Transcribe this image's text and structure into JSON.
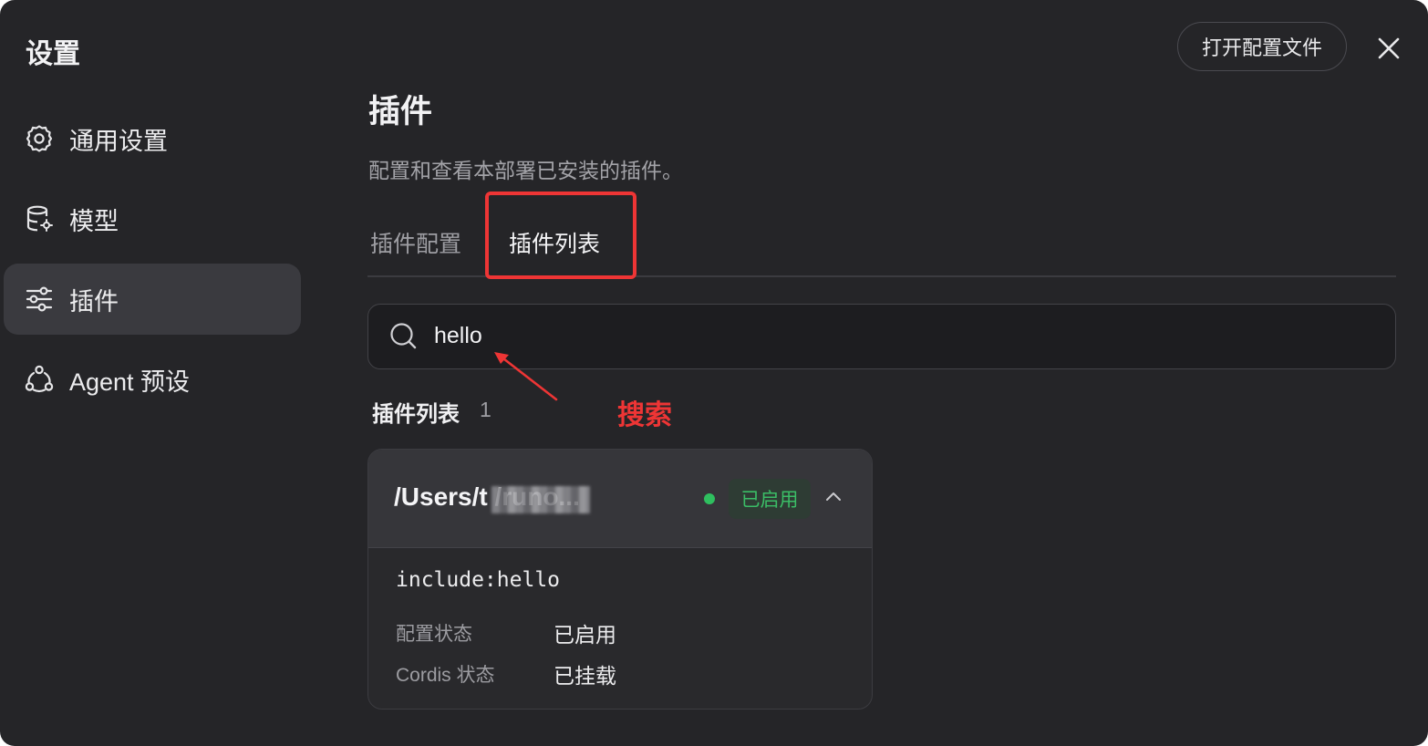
{
  "window": {
    "title": "设置",
    "open_config_label": "打开配置文件"
  },
  "sidebar": {
    "items": [
      {
        "label": "通用设置",
        "icon": "gear-icon"
      },
      {
        "label": "模型",
        "icon": "database-icon"
      },
      {
        "label": "插件",
        "icon": "sliders-icon",
        "active": true
      },
      {
        "label": "Agent 预设",
        "icon": "agent-network-icon"
      }
    ]
  },
  "main": {
    "title": "插件",
    "description": "配置和查看本部署已安装的插件。",
    "tabs": [
      {
        "label": "插件配置"
      },
      {
        "label": "插件列表",
        "active": true
      }
    ],
    "search": {
      "value": "hello"
    },
    "list": {
      "heading": "插件列表",
      "count": "1"
    },
    "plugin": {
      "path": "/Users/t        /runo...",
      "status_badge": "已启用",
      "include": "include:hello",
      "rows": [
        {
          "label": "配置状态",
          "value": "已启用"
        },
        {
          "label": "Cordis 状态",
          "value": "已挂载"
        }
      ]
    }
  },
  "annotation": {
    "text": "搜索"
  },
  "colors": {
    "background": "#252528",
    "sidebar_active": "#3a3a3f",
    "annotation_red": "#ee3535",
    "status_green": "#2fbf5f"
  }
}
